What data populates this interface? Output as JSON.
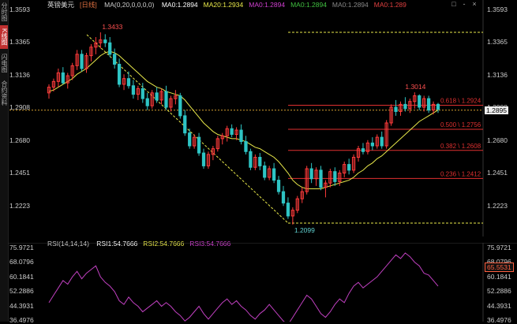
{
  "instrument": "英镑美元",
  "timeframe": "[日线]",
  "legend": {
    "ma": "MA(0,20,0,0,0,0)",
    "items": [
      {
        "text": "MA0:1.2894",
        "color": "#ffffff"
      },
      {
        "text": "MA20:1.2934",
        "color": "#e8e84a"
      },
      {
        "text": "MA0:1.2894",
        "color": "#d040d0"
      },
      {
        "text": "MA0:1.2894",
        "color": "#40c040"
      },
      {
        "text": "MA0:1.2894",
        "color": "#888888"
      },
      {
        "text": "MA0:1.289",
        "color": "#e04040"
      }
    ]
  },
  "sidebar_tabs": [
    {
      "label": "分时图",
      "active": false
    },
    {
      "label": "K线图",
      "active": true
    },
    {
      "label": "闪电图",
      "active": false
    },
    {
      "label": "合约资料",
      "active": false
    }
  ],
  "window_controls": [
    "□",
    "-",
    "×"
  ],
  "price_axis": [
    "1.3593",
    "1.3365",
    "1.3136",
    "1.2908",
    "1.2680",
    "1.2451",
    "1.2223"
  ],
  "price_axis_right": [
    "1.3593",
    "1.3365",
    "1.3136",
    "1.2908",
    "1.2680",
    "1.2451",
    "1.2223"
  ],
  "current_price": "1.2895",
  "annotations": {
    "high": "1.3433",
    "low": "1.2099",
    "recent_high": "1.3014"
  },
  "fib_levels": [
    {
      "label": "0.618 \\ 1.2924",
      "value": 1.2924
    },
    {
      "label": "0.500 \\ 1.2756",
      "value": 1.2756
    },
    {
      "label": "0.382 \\ 1.2608",
      "value": 1.2608
    },
    {
      "label": "0.236 \\ 1.2412",
      "value": 1.2412
    }
  ],
  "rsi_legend": {
    "title": "RSI(14,14,14)",
    "items": [
      {
        "text": "RSI1:54.7666",
        "color": "#ffffff"
      },
      {
        "text": "RSI2:54.7666",
        "color": "#e8e84a"
      },
      {
        "text": "RSI3:54.7666",
        "color": "#d040d0"
      }
    ]
  },
  "rsi_axis": [
    "75.9721",
    "68.0796",
    "60.1841",
    "52.2886",
    "44.3931",
    "36.4976"
  ],
  "rsi_current": "65.5531",
  "colors": {
    "up": "#ff3b3b",
    "down": "#2ec4c4",
    "ma20": "#e8e84a",
    "rsi": "#c040c0",
    "fib": "#e03030",
    "trend": "#e8e84a"
  },
  "chart_data": {
    "type": "candlestick",
    "price_range": [
      1.199,
      1.3593
    ],
    "candles": [
      [
        1.301,
        1.307,
        1.297,
        1.305
      ],
      [
        1.305,
        1.311,
        1.302,
        1.309
      ],
      [
        1.309,
        1.318,
        1.305,
        1.315
      ],
      [
        1.315,
        1.319,
        1.307,
        1.308
      ],
      [
        1.308,
        1.315,
        1.304,
        1.313
      ],
      [
        1.313,
        1.322,
        1.31,
        1.32
      ],
      [
        1.32,
        1.331,
        1.317,
        1.328
      ],
      [
        1.328,
        1.331,
        1.316,
        1.318
      ],
      [
        1.318,
        1.329,
        1.315,
        1.327
      ],
      [
        1.327,
        1.335,
        1.323,
        1.333
      ],
      [
        1.333,
        1.34,
        1.328,
        1.336
      ],
      [
        1.336,
        1.3433,
        1.332,
        1.338
      ],
      [
        1.338,
        1.342,
        1.333,
        1.336
      ],
      [
        1.336,
        1.34,
        1.326,
        1.328
      ],
      [
        1.328,
        1.332,
        1.318,
        1.321
      ],
      [
        1.321,
        1.325,
        1.305,
        1.307
      ],
      [
        1.307,
        1.314,
        1.303,
        1.311
      ],
      [
        1.311,
        1.316,
        1.304,
        1.306
      ],
      [
        1.306,
        1.31,
        1.297,
        1.3
      ],
      [
        1.3,
        1.306,
        1.296,
        1.304
      ],
      [
        1.304,
        1.308,
        1.294,
        1.297
      ],
      [
        1.297,
        1.301,
        1.289,
        1.292
      ],
      [
        1.292,
        1.303,
        1.29,
        1.301
      ],
      [
        1.301,
        1.305,
        1.294,
        1.296
      ],
      [
        1.296,
        1.304,
        1.293,
        1.302
      ],
      [
        1.302,
        1.306,
        1.289,
        1.291
      ],
      [
        1.291,
        1.299,
        1.288,
        1.297
      ],
      [
        1.297,
        1.303,
        1.293,
        1.299
      ],
      [
        1.299,
        1.301,
        1.283,
        1.285
      ],
      [
        1.285,
        1.289,
        1.271,
        1.273
      ],
      [
        1.273,
        1.276,
        1.262,
        1.264
      ],
      [
        1.264,
        1.272,
        1.262,
        1.27
      ],
      [
        1.27,
        1.273,
        1.257,
        1.259
      ],
      [
        1.259,
        1.262,
        1.248,
        1.25
      ],
      [
        1.25,
        1.26,
        1.248,
        1.258
      ],
      [
        1.258,
        1.264,
        1.254,
        1.262
      ],
      [
        1.262,
        1.271,
        1.26,
        1.269
      ],
      [
        1.269,
        1.273,
        1.265,
        1.271
      ],
      [
        1.271,
        1.278,
        1.267,
        1.276
      ],
      [
        1.276,
        1.279,
        1.27,
        1.272
      ],
      [
        1.272,
        1.277,
        1.268,
        1.275
      ],
      [
        1.275,
        1.279,
        1.265,
        1.267
      ],
      [
        1.267,
        1.271,
        1.258,
        1.26
      ],
      [
        1.26,
        1.262,
        1.247,
        1.249
      ],
      [
        1.249,
        1.258,
        1.247,
        1.256
      ],
      [
        1.256,
        1.259,
        1.247,
        1.25
      ],
      [
        1.25,
        1.253,
        1.24,
        1.242
      ],
      [
        1.242,
        1.25,
        1.24,
        1.248
      ],
      [
        1.248,
        1.252,
        1.238,
        1.24
      ],
      [
        1.24,
        1.243,
        1.23,
        1.232
      ],
      [
        1.232,
        1.236,
        1.222,
        1.224
      ],
      [
        1.224,
        1.228,
        1.213,
        1.215
      ],
      [
        1.215,
        1.221,
        1.209,
        1.219
      ],
      [
        1.219,
        1.229,
        1.217,
        1.227
      ],
      [
        1.227,
        1.235,
        1.224,
        1.232
      ],
      [
        1.232,
        1.25,
        1.23,
        1.248
      ],
      [
        1.248,
        1.252,
        1.238,
        1.241
      ],
      [
        1.241,
        1.249,
        1.236,
        1.247
      ],
      [
        1.247,
        1.25,
        1.233,
        1.235
      ],
      [
        1.235,
        1.24,
        1.228,
        1.238
      ],
      [
        1.238,
        1.248,
        1.235,
        1.246
      ],
      [
        1.246,
        1.249,
        1.236,
        1.239
      ],
      [
        1.239,
        1.247,
        1.236,
        1.245
      ],
      [
        1.245,
        1.253,
        1.242,
        1.251
      ],
      [
        1.251,
        1.255,
        1.244,
        1.247
      ],
      [
        1.247,
        1.258,
        1.245,
        1.256
      ],
      [
        1.256,
        1.264,
        1.253,
        1.262
      ],
      [
        1.262,
        1.266,
        1.258,
        1.26
      ],
      [
        1.26,
        1.268,
        1.258,
        1.266
      ],
      [
        1.266,
        1.27,
        1.261,
        1.264
      ],
      [
        1.264,
        1.272,
        1.262,
        1.27
      ],
      [
        1.27,
        1.274,
        1.262,
        1.264
      ],
      [
        1.264,
        1.282,
        1.262,
        1.28
      ],
      [
        1.28,
        1.293,
        1.278,
        1.291
      ],
      [
        1.291,
        1.296,
        1.285,
        1.288
      ],
      [
        1.288,
        1.295,
        1.285,
        1.293
      ],
      [
        1.293,
        1.298,
        1.288,
        1.29
      ],
      [
        1.29,
        1.297,
        1.287,
        1.295
      ],
      [
        1.295,
        1.3014,
        1.29,
        1.299
      ],
      [
        1.299,
        1.3,
        1.289,
        1.291
      ],
      [
        1.291,
        1.299,
        1.288,
        1.297
      ],
      [
        1.297,
        1.299,
        1.287,
        1.289
      ],
      [
        1.289,
        1.295,
        1.286,
        1.293
      ],
      [
        1.293,
        1.294,
        1.287,
        1.2895
      ]
    ],
    "ma20": [
      1.302,
      1.303,
      1.305,
      1.307,
      1.309,
      1.311,
      1.314,
      1.316,
      1.318,
      1.321,
      1.324,
      1.327,
      1.329,
      1.33,
      1.329,
      1.327,
      1.324,
      1.321,
      1.318,
      1.315,
      1.312,
      1.309,
      1.307,
      1.305,
      1.304,
      1.302,
      1.301,
      1.3,
      1.299,
      1.296,
      1.292,
      1.288,
      1.284,
      1.28,
      1.277,
      1.274,
      1.272,
      1.271,
      1.27,
      1.269,
      1.269,
      1.268,
      1.267,
      1.265,
      1.263,
      1.262,
      1.26,
      1.258,
      1.256,
      1.253,
      1.249,
      1.245,
      1.24,
      1.237,
      1.235,
      1.234,
      1.234,
      1.234,
      1.234,
      1.235,
      1.236,
      1.237,
      1.238,
      1.239,
      1.24,
      1.242,
      1.245,
      1.247,
      1.25,
      1.252,
      1.255,
      1.257,
      1.26,
      1.263,
      1.266,
      1.269,
      1.272,
      1.275,
      1.278,
      1.281,
      1.283,
      1.285,
      1.287,
      1.289
    ],
    "rsi": [
      46,
      50,
      54,
      58,
      56,
      60,
      63,
      59,
      62,
      64,
      66,
      60,
      57,
      55,
      52,
      47,
      45,
      49,
      46,
      44,
      41,
      43,
      45,
      47,
      44,
      46,
      44,
      41,
      39,
      36,
      38,
      41,
      44,
      40,
      37,
      40,
      43,
      46,
      48,
      45,
      47,
      44,
      42,
      39,
      37,
      40,
      42,
      45,
      42,
      39,
      36,
      34,
      38,
      42,
      46,
      50,
      48,
      44,
      40,
      38,
      41,
      45,
      48,
      46,
      51,
      55,
      57,
      54,
      56,
      58,
      60,
      63,
      66,
      69,
      72,
      70,
      73,
      71,
      68,
      66,
      62,
      61,
      58,
      55
    ]
  }
}
